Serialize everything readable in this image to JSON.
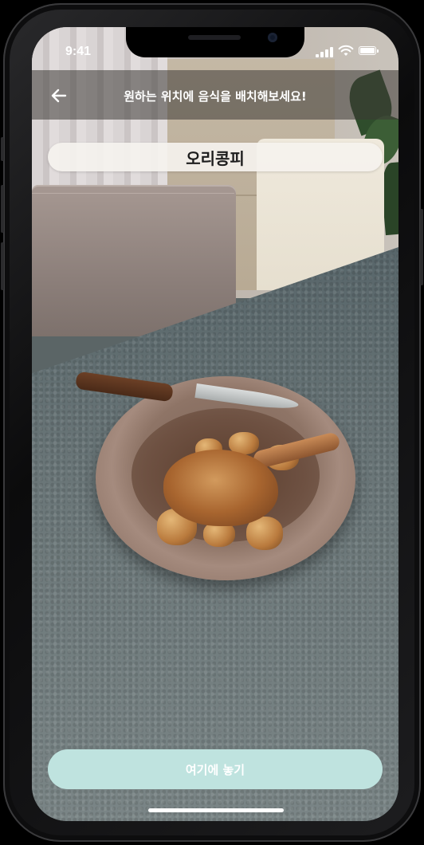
{
  "status_bar": {
    "time": "9:41",
    "signal_icon": "cellular-signal-icon",
    "wifi_icon": "wifi-icon",
    "battery_icon": "battery-icon"
  },
  "header": {
    "back_icon": "arrow-left-icon",
    "title": "원하는 위치에 음식을 배치해보세요!"
  },
  "food": {
    "name": "오리콩피"
  },
  "actions": {
    "place_label": "여기에 놓기",
    "place_button_color": "#bfe3df"
  }
}
